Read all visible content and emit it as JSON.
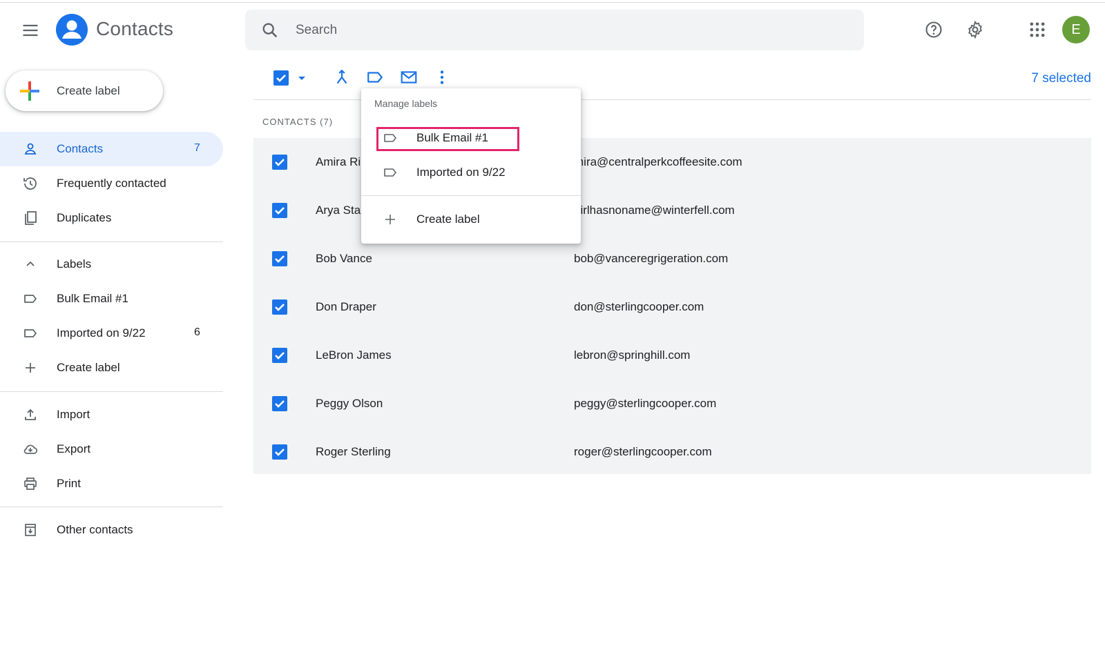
{
  "header": {
    "app_title": "Contacts",
    "search_placeholder": "Search",
    "avatar_letter": "E",
    "icons": [
      "menu-icon",
      "contacts-logo",
      "search-icon",
      "help-icon",
      "settings-icon",
      "apps-icon"
    ]
  },
  "sidebar": {
    "create_label": "Create label",
    "items": [
      {
        "label": "Contacts",
        "count": "7",
        "icon": "person-icon",
        "active": true
      },
      {
        "label": "Frequently contacted",
        "count": "",
        "icon": "history-icon"
      },
      {
        "label": "Duplicates",
        "count": "",
        "icon": "duplicates-icon"
      }
    ],
    "labels_header": "Labels",
    "labels": [
      {
        "label": "Bulk Email #1",
        "count": ""
      },
      {
        "label": "Imported on 9/22",
        "count": "6"
      }
    ],
    "tools": [
      {
        "label": "Import",
        "icon": "upload-icon"
      },
      {
        "label": "Export",
        "icon": "cloud-download-icon"
      },
      {
        "label": "Print",
        "icon": "print-icon"
      }
    ],
    "other_contacts": "Other contacts"
  },
  "toolbar": {
    "selected_text": "7 selected",
    "icons": [
      "select-all-checkbox",
      "select-dropdown-icon",
      "merge-icon",
      "label-icon",
      "email-icon",
      "more-vert-icon"
    ]
  },
  "list": {
    "section_title": "CONTACTS (7)",
    "rows": [
      {
        "name": "Amira Ri",
        "email": "mira@centralperkcoffeesite.com"
      },
      {
        "name": "Arya Sta",
        "email": "girlhasnoname@winterfell.com"
      },
      {
        "name": "Bob Vance",
        "email": "bob@vanceregrigeration.com"
      },
      {
        "name": "Don Draper",
        "email": "don@sterlingcooper.com"
      },
      {
        "name": "LeBron James",
        "email": "lebron@springhill.com"
      },
      {
        "name": "Peggy Olson",
        "email": "peggy@sterlingcooper.com"
      },
      {
        "name": "Roger Sterling",
        "email": "roger@sterlingcooper.com"
      }
    ]
  },
  "menu": {
    "title": "Manage labels",
    "items": [
      "Bulk Email #1",
      "Imported on 9/22"
    ],
    "create": "Create label"
  },
  "colors": {
    "accent": "#1a73e8",
    "active_bg": "#e8f0fe",
    "highlight": "#e3256b",
    "avatar": "#689f38"
  }
}
